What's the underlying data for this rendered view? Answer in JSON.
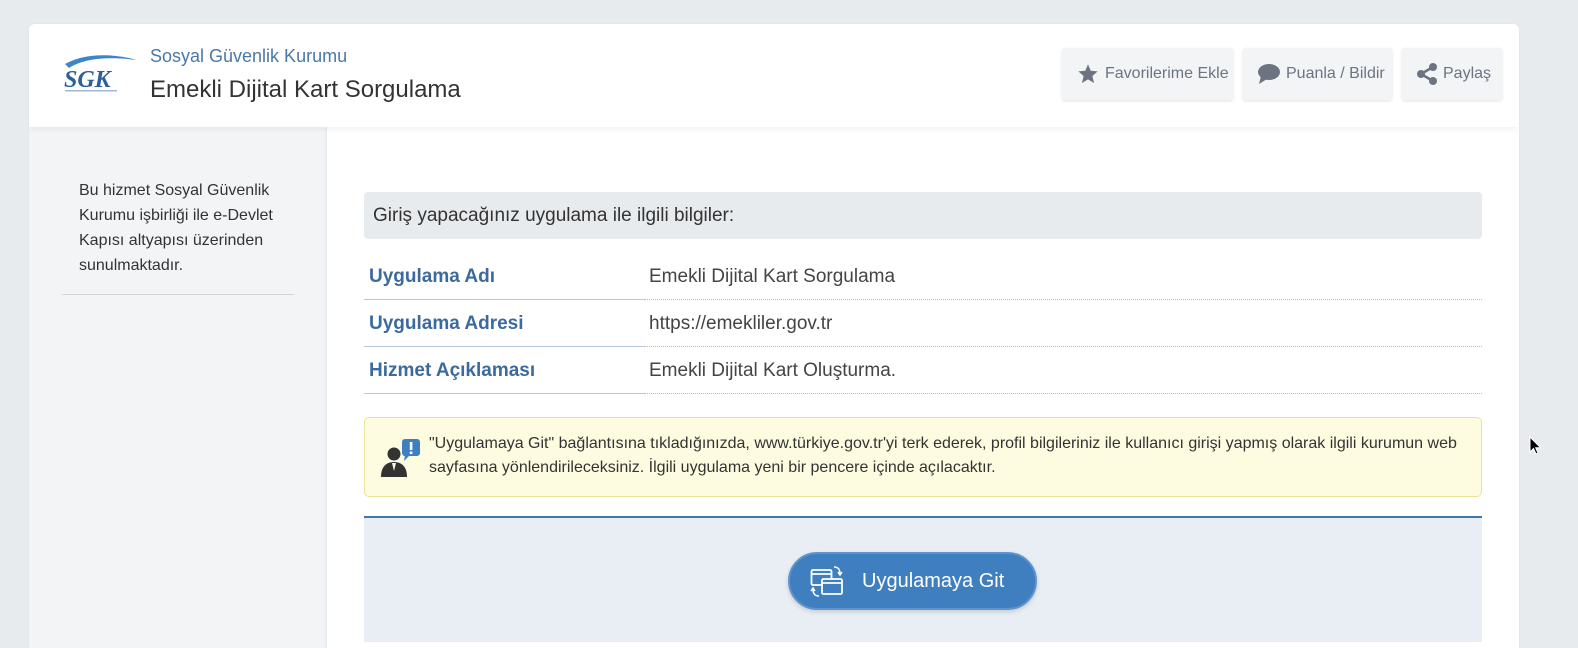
{
  "header": {
    "logo_text": "SGK",
    "org_name": "Sosyal Güvenlik Kurumu",
    "title": "Emekli Dijital Kart Sorgulama",
    "buttons": {
      "favorite": "Favorilerime Ekle",
      "rate": "Puanla / Bildir",
      "share": "Paylaş"
    }
  },
  "sidebar": {
    "text": "Bu hizmet Sosyal Güvenlik Kurumu işbirliği ile e-Devlet Kapısı altyapısı üzerinden sunulmaktadır."
  },
  "main": {
    "info_title": "Giriş yapacağınız uygulama ile ilgili bilgiler:",
    "rows": [
      {
        "label": "Uygulama Adı",
        "value": "Emekli Dijital Kart Sorgulama"
      },
      {
        "label": "Uygulama Adresi",
        "value": "https://emekliler.gov.tr"
      },
      {
        "label": "Hizmet Açıklaması",
        "value": "Emekli Dijital Kart Oluşturma."
      }
    ],
    "notice": "\"Uygulamaya Git\" bağlantısına tıkladığınızda, www.türkiye.gov.tr'yi terk ederek, profil bilgileriniz ile kullanıcı girişi yapmış olarak ilgili kurumun web sayfasına yönlendirileceksiniz. İlgili uygulama yeni bir pencere içinde açılacaktır.",
    "go_button": "Uygulamaya Git"
  },
  "icons": {
    "logo": "sgk-logo",
    "favorite": "star-icon",
    "rate": "speech-bubble-icon",
    "share": "share-icon",
    "notice": "user-alert-icon",
    "go": "browser-windows-icon"
  },
  "colors": {
    "brand_blue": "#3f7fbf",
    "label_blue": "#3d6a9e",
    "notice_bg": "#fdfbe0"
  }
}
